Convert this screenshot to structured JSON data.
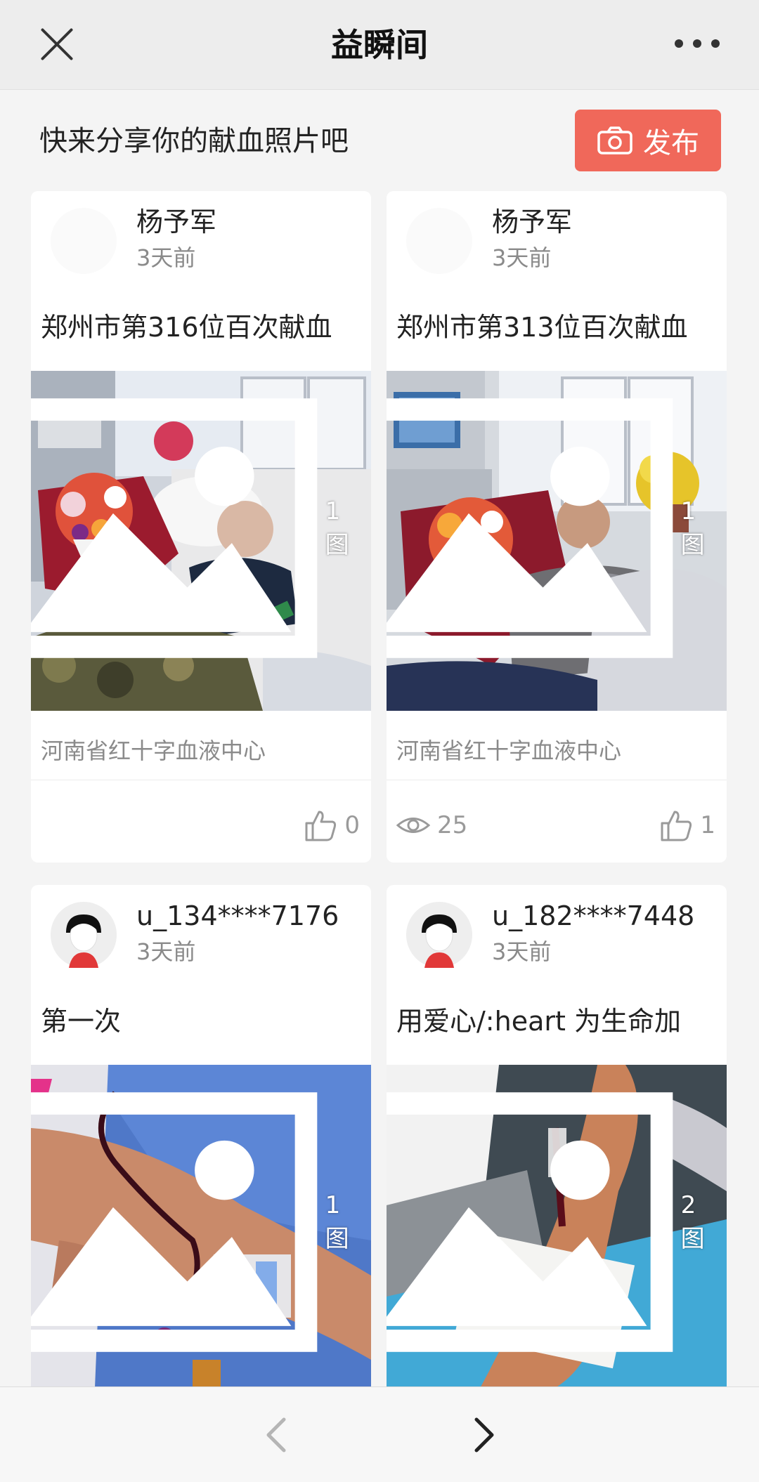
{
  "header": {
    "title": "益瞬间"
  },
  "share": {
    "prompt": "快来分享你的献血照片吧",
    "publish_label": "发布"
  },
  "posts": [
    {
      "author": "杨予军",
      "time": "3天前",
      "title": "郑州市第316位百次献血",
      "image_count": "1图",
      "org": "河南省红十字血液中心",
      "views": "",
      "likes": "0"
    },
    {
      "author": "杨予军",
      "time": "3天前",
      "title": "郑州市第313位百次献血",
      "image_count": "1图",
      "org": "河南省红十字血液中心",
      "views": "25",
      "likes": "1"
    },
    {
      "author": "u_134****7176",
      "time": "3天前",
      "title": "第一次",
      "image_count": "1图"
    },
    {
      "author": "u_182****7448",
      "time": "3天前",
      "title": "用爱心/:heart 为生命加",
      "image_count": "2图"
    }
  ],
  "colors": {
    "accent": "#f0685a",
    "header_bg": "#ededed",
    "page_bg": "#f4f4f4"
  },
  "icons": {
    "close": "close-icon",
    "more": "more-icon",
    "camera": "camera-icon",
    "image": "image-icon",
    "eye": "eye-icon",
    "like": "thumb-up-icon",
    "prev": "chevron-left-icon",
    "next": "chevron-right-icon"
  }
}
